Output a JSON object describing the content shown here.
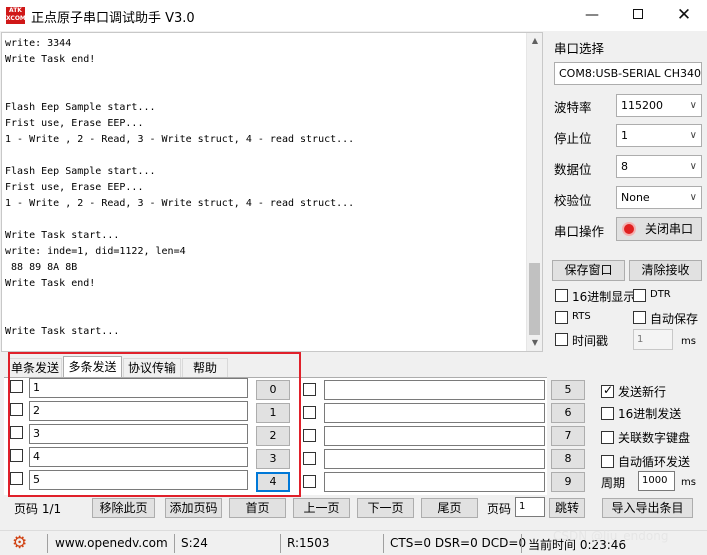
{
  "window": {
    "logo_text": "ATK\nXCOM",
    "title": "正点原子串口调试助手 V3.0",
    "minimize_icon": "minimize-icon",
    "maximize_icon": "maximize-icon",
    "close_icon": "close-icon"
  },
  "log": {
    "text": "write: 3344\nWrite Task end!\n\n\nFlash Eep Sample start...\nFrist use, Erase EEP...\n1 - Write , 2 - Read, 3 - Write struct, 4 - read struct...\n\nFlash Eep Sample start...\nFrist use, Erase EEP...\n1 - Write , 2 - Read, 3 - Write struct, 4 - read struct...\n\nWrite Task start...\nwrite: inde=1, did=1122, len=4\n 88 89 8A 8B\nWrite Task end!\n\n\nWrite Task start..."
  },
  "serial": {
    "section_label": "串口选择",
    "port_value": "COM8:USB-SERIAL CH340",
    "baud_label": "波特率",
    "baud_value": "115200",
    "stopbits_label": "停止位",
    "stopbits_value": "1",
    "databits_label": "数据位",
    "databits_value": "8",
    "parity_label": "校验位",
    "parity_value": "None",
    "operation_label": "串口操作",
    "close_port_button": "关闭串口",
    "save_window_button": "保存窗口",
    "clear_receive_button": "清除接收",
    "hex_display_label": "16进制显示",
    "dtr_label": "DTR",
    "rts_label": "RTS",
    "auto_save_label": "自动保存",
    "timestamp_label": "时间戳",
    "timestamp_value": "1",
    "timestamp_unit": "ms"
  },
  "tabs": [
    {
      "label": "单条发送"
    },
    {
      "label": "多条发送"
    },
    {
      "label": "协议传输"
    },
    {
      "label": "帮助"
    }
  ],
  "multi_send": {
    "left_rows": [
      {
        "value": "1",
        "button": "0",
        "checked": false
      },
      {
        "value": "2",
        "button": "1",
        "checked": false
      },
      {
        "value": "3",
        "button": "2",
        "checked": false
      },
      {
        "value": "4",
        "button": "3",
        "checked": false
      },
      {
        "value": "5",
        "button": "4",
        "checked": false
      }
    ],
    "right_rows": [
      {
        "value": "",
        "button": "5",
        "checked": false
      },
      {
        "value": "",
        "button": "6",
        "checked": false
      },
      {
        "value": "",
        "button": "7",
        "checked": false
      },
      {
        "value": "",
        "button": "8",
        "checked": false
      },
      {
        "value": "",
        "button": "9",
        "checked": false
      }
    ],
    "send_newline_label": "发送新行",
    "send_newline_checked": true,
    "hex_send_label": "16进制发送",
    "numpad_label": "关联数字键盘",
    "auto_loop_label": "自动循环发送",
    "period_label": "周期",
    "period_value": "1000",
    "period_unit": "ms"
  },
  "pager": {
    "page_info": "页码 1/1",
    "remove_page": "移除此页",
    "add_page": "添加页码",
    "first_page": "首页",
    "prev_page": "上一页",
    "next_page": "下一页",
    "last_page": "尾页",
    "page_label": "页码",
    "page_value": "1",
    "jump": "跳转",
    "import_export": "导入导出条目"
  },
  "status": {
    "settings_icon": "gear-icon",
    "website": "www.openedv.com",
    "sent": "S:24",
    "received": "R:1503",
    "signals": "CTS=0 DSR=0 DCD=0",
    "time": "当前时间 0:23:46",
    "watermark": "CSDN @liu_endong"
  }
}
